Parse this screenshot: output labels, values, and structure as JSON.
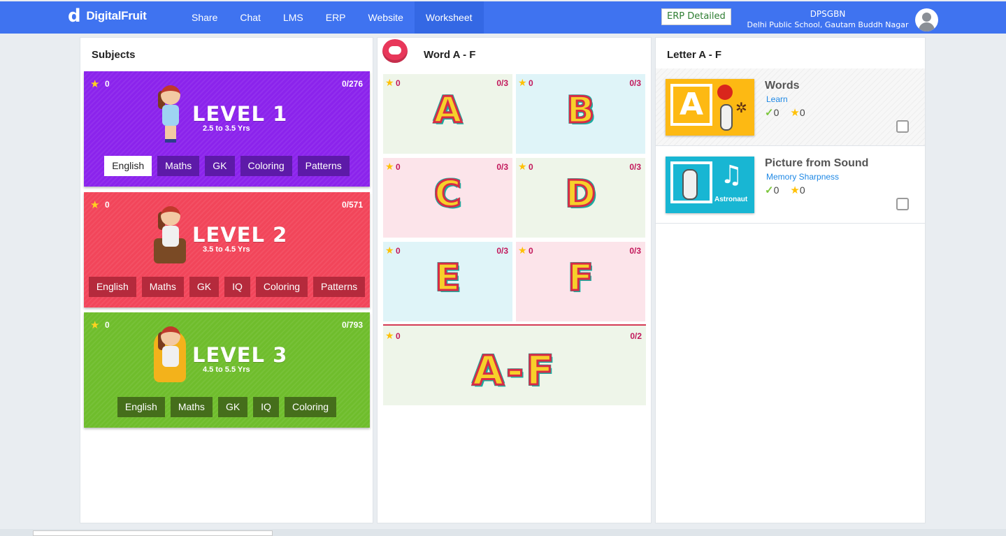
{
  "header": {
    "brand": "DigitalFruit",
    "brand_logo": "d",
    "nav": [
      "Share",
      "Chat",
      "LMS",
      "ERP",
      "Website",
      "Worksheet"
    ],
    "active_nav": "Worksheet",
    "erp_button": "ERP Detailed",
    "user_code": "DPSGBN",
    "school": "Delhi Public School, Gautam Buddh Nagar",
    "accent_color": "#3f73f0"
  },
  "subjects": {
    "title": "Subjects",
    "levels": [
      {
        "title": "LEVEL 1",
        "age": "2.5 to 3.5 Yrs",
        "stars": "0",
        "progress": "0/276",
        "color": "#8b23ec",
        "tags": [
          "English",
          "Maths",
          "GK",
          "Coloring",
          "Patterns"
        ],
        "selected": "English"
      },
      {
        "title": "LEVEL 2",
        "age": "3.5 to 4.5 Yrs",
        "stars": "0",
        "progress": "0/571",
        "color": "#f2455a",
        "tags": [
          "English",
          "Maths",
          "GK",
          "IQ",
          "Coloring",
          "Patterns"
        ]
      },
      {
        "title": "LEVEL 3",
        "age": "4.5 to 5.5 Yrs",
        "stars": "0",
        "progress": "0/793",
        "color": "#6fbd2c",
        "tags": [
          "English",
          "Maths",
          "GK",
          "IQ",
          "Coloring"
        ]
      }
    ]
  },
  "word": {
    "title": "Word A - F",
    "tiles": [
      {
        "letter": "A",
        "stars": "0",
        "progress": "0/3"
      },
      {
        "letter": "B",
        "stars": "0",
        "progress": "0/3"
      },
      {
        "letter": "C",
        "stars": "0",
        "progress": "0/3"
      },
      {
        "letter": "D",
        "stars": "0",
        "progress": "0/3"
      },
      {
        "letter": "E",
        "stars": "0",
        "progress": "0/3"
      },
      {
        "letter": "F",
        "stars": "0",
        "progress": "0/3"
      }
    ],
    "summary": {
      "letter": "A-F",
      "stars": "0",
      "progress": "0/2"
    }
  },
  "letter": {
    "title": "Letter A - F",
    "activities": [
      {
        "name": "Words",
        "sub": "Learn",
        "done": "0",
        "stars": "0",
        "thumb_letter": "A"
      },
      {
        "name": "Picture from Sound",
        "sub": "Memory Sharpness",
        "done": "0",
        "stars": "0",
        "thumb_caption": "Astronaut"
      }
    ]
  }
}
